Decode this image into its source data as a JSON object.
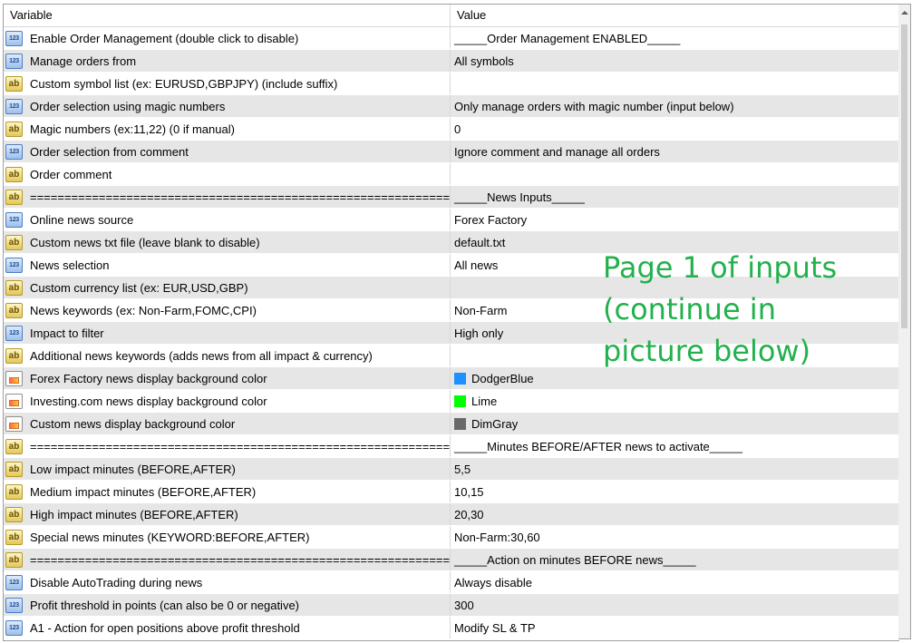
{
  "header": {
    "variable_label": "Variable",
    "value_label": "Value"
  },
  "colors": {
    "DodgerBlue": "#1e90ff",
    "Lime": "#00ff00",
    "DimGray": "#696969",
    "overlay_text": "#22b14c"
  },
  "rows": [
    {
      "type": "num",
      "icon": "123",
      "name": "Enable Order Management (double click to disable)",
      "value": "_____Order Management ENABLED_____"
    },
    {
      "type": "num",
      "icon": "123",
      "name": "Manage orders from",
      "value": "All symbols"
    },
    {
      "type": "txt",
      "icon": "ab",
      "name": "Custom symbol list (ex: EURUSD,GBPJPY) (include suffix)",
      "value": ""
    },
    {
      "type": "num",
      "icon": "123",
      "name": "Order selection using magic numbers",
      "value": "Only manage orders with magic number (input below)"
    },
    {
      "type": "txt",
      "icon": "ab",
      "name": "Magic numbers (ex:11,22) (0 if manual)",
      "value": "0"
    },
    {
      "type": "num",
      "icon": "123",
      "name": "Order selection from comment",
      "value": "Ignore comment and manage all orders"
    },
    {
      "type": "txt",
      "icon": "ab",
      "name": "Order comment",
      "value": ""
    },
    {
      "type": "txt",
      "icon": "ab",
      "name": "================================================================",
      "value": "_____News Inputs_____"
    },
    {
      "type": "num",
      "icon": "123",
      "name": "Online news source",
      "value": "Forex Factory"
    },
    {
      "type": "txt",
      "icon": "ab",
      "name": "Custom news txt file (leave blank to disable)",
      "value": "default.txt"
    },
    {
      "type": "num",
      "icon": "123",
      "name": "News selection",
      "value": "All news"
    },
    {
      "type": "txt",
      "icon": "ab",
      "name": "Custom currency list (ex: EUR,USD,GBP)",
      "value": ""
    },
    {
      "type": "txt",
      "icon": "ab",
      "name": "News keywords (ex: Non-Farm,FOMC,CPI)",
      "value": "Non-Farm"
    },
    {
      "type": "num",
      "icon": "123",
      "name": "Impact to filter",
      "value": "High only"
    },
    {
      "type": "txt",
      "icon": "ab",
      "name": "Additional news keywords (adds news from all impact & currency)",
      "value": ""
    },
    {
      "type": "col",
      "icon": "color-icon",
      "name": "Forex Factory news display background color",
      "value": "DodgerBlue",
      "swatch": "#1e90ff"
    },
    {
      "type": "col",
      "icon": "color-icon",
      "name": "Investing.com news display background color",
      "value": "Lime",
      "swatch": "#00ff00"
    },
    {
      "type": "col",
      "icon": "color-icon",
      "name": "Custom news display background color",
      "value": "DimGray",
      "swatch": "#696969"
    },
    {
      "type": "txt",
      "icon": "ab",
      "name": "================================================================",
      "value": "_____Minutes BEFORE/AFTER news to activate_____"
    },
    {
      "type": "txt",
      "icon": "ab",
      "name": "Low impact minutes (BEFORE,AFTER)",
      "value": "5,5"
    },
    {
      "type": "txt",
      "icon": "ab",
      "name": "Medium impact minutes (BEFORE,AFTER)",
      "value": "10,15"
    },
    {
      "type": "txt",
      "icon": "ab",
      "name": "High impact minutes (BEFORE,AFTER)",
      "value": "20,30"
    },
    {
      "type": "txt",
      "icon": "ab",
      "name": "Special news minutes (KEYWORD:BEFORE,AFTER)",
      "value": "Non-Farm:30,60"
    },
    {
      "type": "txt",
      "icon": "ab",
      "name": "================================================================",
      "value": "_____Action on minutes BEFORE news_____"
    },
    {
      "type": "num",
      "icon": "123",
      "name": "Disable AutoTrading during news",
      "value": "Always disable"
    },
    {
      "type": "num",
      "icon": "123",
      "name": "Profit threshold in points (can also be 0 or negative)",
      "value": "300"
    },
    {
      "type": "num",
      "icon": "123",
      "name": "A1 - Action for open positions above profit threshold",
      "value": "Modify SL & TP"
    }
  ],
  "overlay": {
    "line1": "Page 1 of inputs",
    "line2": "(continue in",
    "line3": "picture below)"
  }
}
